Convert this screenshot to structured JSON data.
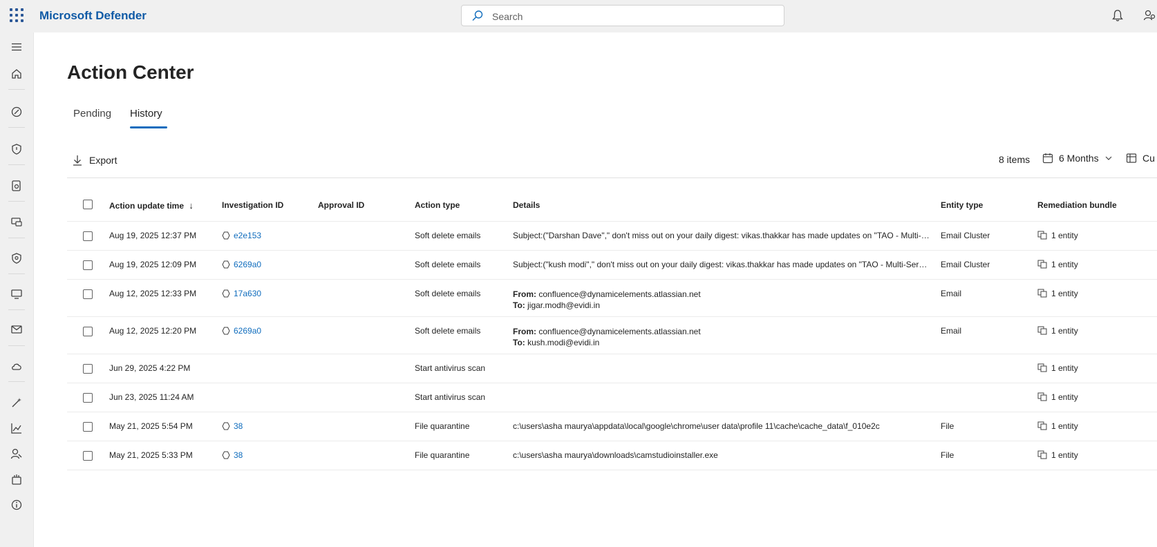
{
  "app": {
    "title": "Microsoft Defender"
  },
  "search": {
    "placeholder": "Search"
  },
  "page": {
    "title": "Action Center"
  },
  "tabs": [
    {
      "label": "Pending"
    },
    {
      "label": "History"
    }
  ],
  "toolbar": {
    "export_label": "Export",
    "items_count": "8 items",
    "range_label": "6 Months",
    "customize_label": "Cu"
  },
  "table": {
    "columns": [
      "Action update time",
      "Investigation ID",
      "Approval ID",
      "Action type",
      "Details",
      "Entity type",
      "Remediation bundle"
    ],
    "sort_indicator": "↓",
    "rows": [
      {
        "time": "Aug 19, 2025 12:37 PM",
        "investigation_id": "e2e153",
        "approval_id": "",
        "action_type": "Soft delete emails",
        "details": "Subject:(\"Darshan Dave\",\" don't miss out on your daily digest: vikas.thakkar has made updates on \"TAO - Multi-Servic...",
        "entity_type": "Email Cluster",
        "bundle": "1 entity"
      },
      {
        "time": "Aug 19, 2025 12:09 PM",
        "investigation_id": "6269a0",
        "approval_id": "",
        "action_type": "Soft delete emails",
        "details": "Subject:(\"kush modi\",\" don't miss out on your daily digest: vikas.thakkar has made updates on \"TAO - Multi-Service S...",
        "entity_type": "Email Cluster",
        "bundle": "1 entity"
      },
      {
        "time": "Aug 12, 2025 12:33 PM",
        "investigation_id": "17a630",
        "approval_id": "",
        "action_type": "Soft delete emails",
        "from_label": "From:",
        "from": "confluence@dynamicelements.atlassian.net",
        "to_label": "To:",
        "to": "jigar.modh@evidi.in",
        "entity_type": "Email",
        "bundle": "1 entity"
      },
      {
        "time": "Aug 12, 2025 12:20 PM",
        "investigation_id": "6269a0",
        "approval_id": "",
        "action_type": "Soft delete emails",
        "from_label": "From:",
        "from": "confluence@dynamicelements.atlassian.net",
        "to_label": "To:",
        "to": "kush.modi@evidi.in",
        "entity_type": "Email",
        "bundle": "1 entity"
      },
      {
        "time": "Jun 29, 2025 4:22 PM",
        "investigation_id": "",
        "approval_id": "",
        "action_type": "Start antivirus scan",
        "details": "",
        "entity_type": "",
        "bundle": "1 entity"
      },
      {
        "time": "Jun 23, 2025 11:24 AM",
        "investigation_id": "",
        "approval_id": "",
        "action_type": "Start antivirus scan",
        "details": "",
        "entity_type": "",
        "bundle": "1 entity"
      },
      {
        "time": "May 21, 2025 5:54 PM",
        "investigation_id": "38",
        "approval_id": "",
        "action_type": "File quarantine",
        "details": "c:\\users\\asha maurya\\appdata\\local\\google\\chrome\\user data\\profile 11\\cache\\cache_data\\f_010e2c",
        "entity_type": "File",
        "bundle": "1 entity"
      },
      {
        "time": "May 21, 2025 5:33 PM",
        "investigation_id": "38",
        "approval_id": "",
        "action_type": "File quarantine",
        "details": "c:\\users\\asha maurya\\downloads\\camstudioinstaller.exe",
        "entity_type": "File",
        "bundle": "1 entity"
      }
    ]
  },
  "colors": {
    "brand": "#0f5aa6",
    "link": "#0f6cbd",
    "tab_underline": "#0f6cbd",
    "chrome": "#f0f0f0"
  },
  "icons": [
    "waffle-icon",
    "search-icon",
    "bell-icon",
    "person-icon",
    "hamburger-icon",
    "home-icon",
    "incidents-icon",
    "shield-icon",
    "endpoint-icon",
    "devices-icon",
    "identity-icon",
    "cloud-apps-icon",
    "mail-icon",
    "cloud-icon",
    "hunting-icon",
    "reports-icon",
    "partners-icon",
    "permissions-icon",
    "info-icon",
    "download-icon",
    "calendar-icon",
    "chevron-down-icon",
    "customize-icon",
    "investigation-icon",
    "bundle-icon"
  ]
}
